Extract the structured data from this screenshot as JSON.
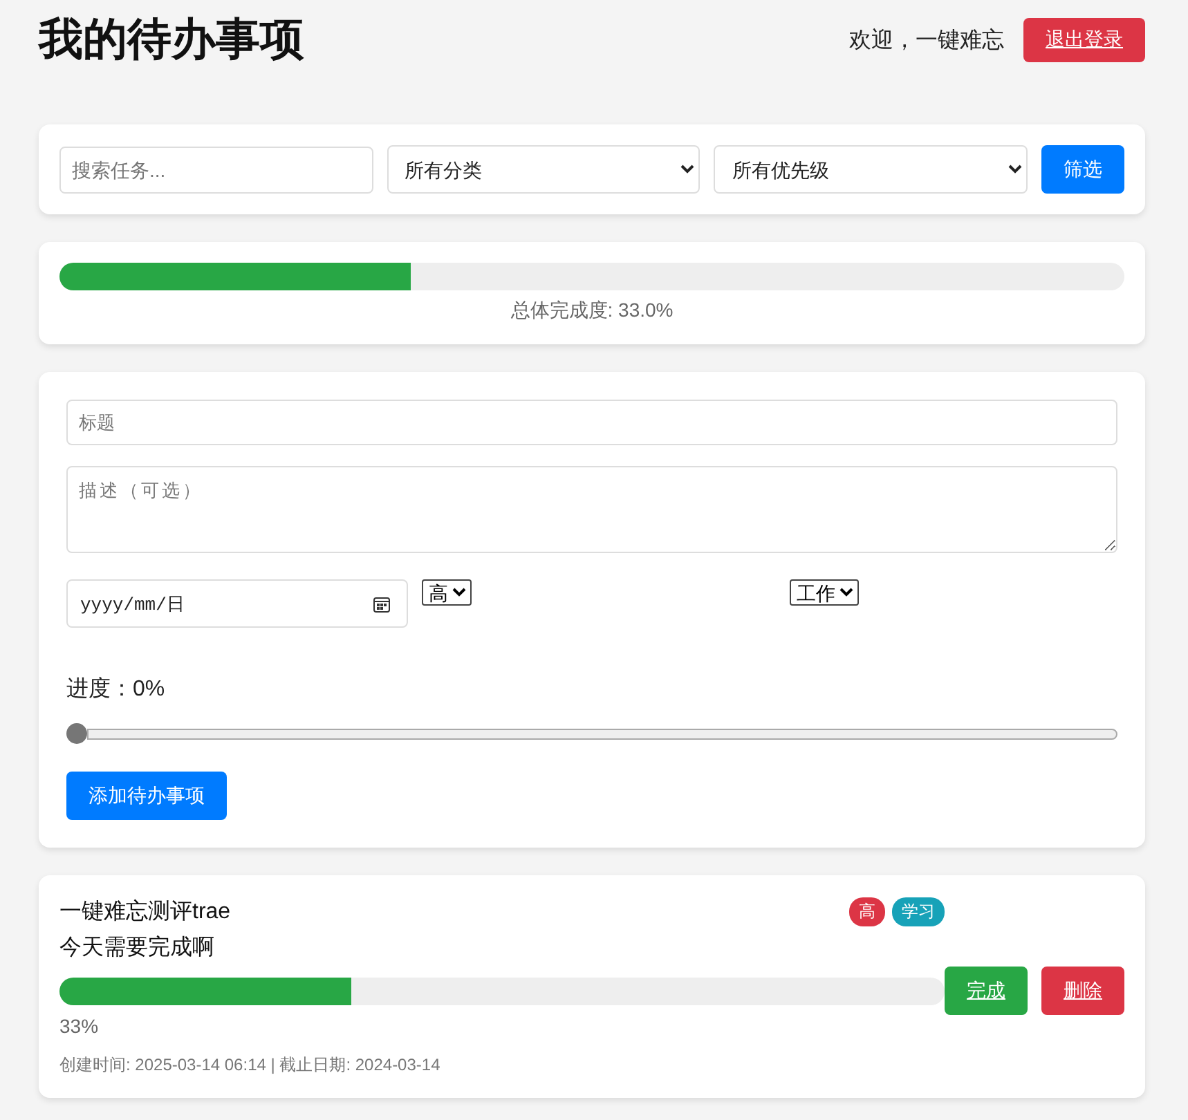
{
  "header": {
    "title": "我的待办事项",
    "welcome": "欢迎，一键难忘",
    "logout": "退出登录"
  },
  "filter": {
    "search_placeholder": "搜索任务...",
    "category": "所有分类",
    "priority": "所有优先级",
    "button": "筛选"
  },
  "overall": {
    "level": 0.33,
    "label": "总体完成度: 33.0%"
  },
  "form": {
    "title_placeholder": "标题",
    "description_placeholder": "描述（可选）",
    "date": "yyyy/mm/日",
    "priority": "高",
    "category": "工作",
    "progress_label": "进度：0%",
    "progress": {
      "level": 0
    },
    "submit": "添加待办事项"
  },
  "tasks": [
    {
      "title": "一键难忘测评trae",
      "description": "今天需要完成啊",
      "tags": [
        {
          "label": "高",
          "color": "#dc3545"
        },
        {
          "label": "学习",
          "color": "#17a2b8"
        }
      ],
      "level": 0.33,
      "percent": "33%",
      "meta": "创建时间: 2025-03-14 06:14 | 截止日期: 2024-03-14",
      "complete": "完成",
      "delete": "删除"
    }
  ]
}
